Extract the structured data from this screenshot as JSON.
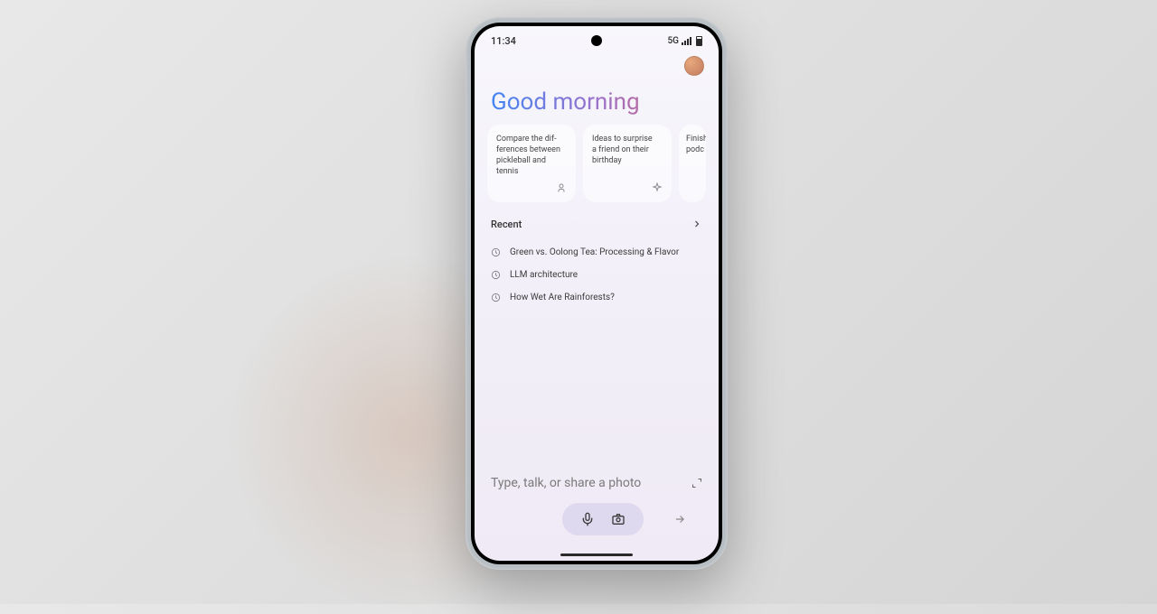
{
  "status": {
    "time": "11:34",
    "network": "5G"
  },
  "greeting": "Good morning",
  "suggestions": [
    {
      "text": "Compare the dif-\nferences between\npickleball and tennis",
      "icon": "person"
    },
    {
      "text": "Ideas to surprise\na friend on their\nbirthday",
      "icon": "sparkle"
    },
    {
      "text": "Finish\npodc",
      "icon": ""
    }
  ],
  "recent": {
    "title": "Recent",
    "items": [
      "Green vs. Oolong Tea: Processing & Flavor",
      "LLM architecture",
      "How Wet Are Rainforests?"
    ]
  },
  "input": {
    "placeholder": "Type, talk, or share a photo"
  }
}
